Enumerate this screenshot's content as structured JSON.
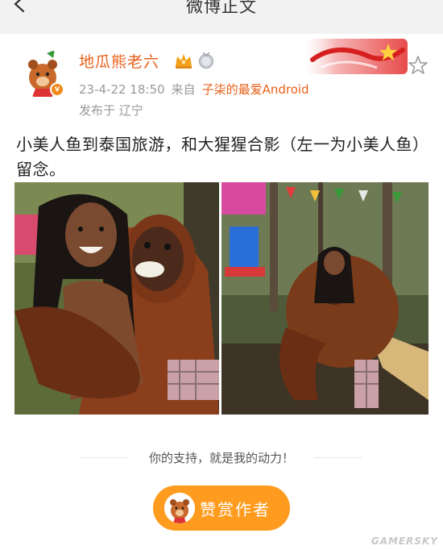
{
  "header": {
    "title": "微博正文"
  },
  "post": {
    "username": "地瓜熊老六",
    "timestamp": "23-4-22 18:50",
    "source_prefix": "来自",
    "source": "子柒的最爱Android",
    "location": "发布于 辽宁",
    "text": "小美人鱼到泰国旅游，和大猩猩合影（左一为小美人鱼）留念。"
  },
  "footer": {
    "support_text": "你的支持，就是我的动力！",
    "reward_label": "赞赏作者"
  },
  "watermark": "GAMERSKY",
  "colors": {
    "accent": "#e8611b",
    "reward_button": "#ff9b1e",
    "meta_gray": "#999999"
  },
  "icons": [
    "back-arrow-icon",
    "crown-badge-icon",
    "medal-badge-icon",
    "star-icon"
  ]
}
